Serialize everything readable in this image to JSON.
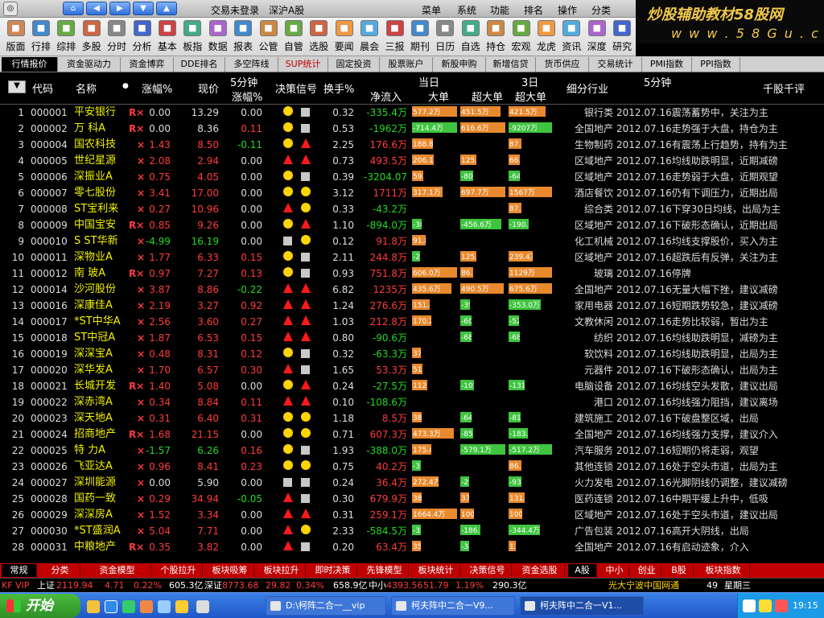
{
  "titlebar": {
    "login": "交易未登录",
    "market": "深沪A股",
    "menus": [
      "菜单",
      "系统",
      "功能",
      "排名",
      "操作",
      "分类"
    ]
  },
  "watermark": {
    "line1": "炒股辅助教材58股网",
    "line2": "w w w . 5 8 G u . c o m"
  },
  "toolbar": [
    "版面",
    "行排",
    "综排",
    "多股",
    "分时",
    "分析",
    "基本",
    "板指",
    "数据",
    "报表",
    "公管",
    "自管",
    "选股",
    "要闻",
    "晨会",
    "三报",
    "期刊",
    "日历",
    "自选",
    "持仓",
    "宏观",
    "龙虎",
    "资讯",
    "深度",
    "研究"
  ],
  "tabs_top": [
    "行情报价",
    "资金驱动力",
    "资金博弈",
    "DDE排名",
    "多空阵线",
    "SUP统计",
    "固定投资",
    "股票账户",
    "新股申购",
    "新增信贷",
    "货币供应",
    "交易统计",
    "PMI指数",
    "PPI指数"
  ],
  "header": {
    "code": "代码",
    "name": "名称",
    "chg": "涨幅%",
    "price": "现价",
    "m5_top": "5分钟",
    "m5": "涨幅%",
    "signal": "决策信号",
    "turnover": "换手%",
    "today": "当日",
    "flow": "净流入",
    "big": "大单",
    "super": "超大单",
    "day3": "3日",
    "d3super": "超大单",
    "industry": "细分行业",
    "comment_5m": "5分钟",
    "comment": "千股千评"
  },
  "colors": {
    "up": "#ff3b3b",
    "down": "#22d822",
    "flat": "#dddddd",
    "name": "#f2f200",
    "bar_pos": "#e8892e",
    "bar_neg": "#3fc43f",
    "signal_yellow": "#ffd400",
    "signal_red": "#ff1a1a",
    "signal_gray": "#c8c8c8"
  },
  "rows": [
    {
      "idx": "1",
      "code": "000001",
      "name": "平安银行",
      "tag": "R×",
      "chg": "0.00",
      "price": "13.29",
      "m5": "0.00",
      "sig": [
        "circle",
        "square"
      ],
      "turn": "0.32",
      "flow": "-335.4万",
      "big": "577.2万",
      "sup": "451.5万",
      "d3": "421.5万",
      "ind": "银行类",
      "cmt": "2012.07.16震荡蓄势中，关注为主"
    },
    {
      "idx": "2",
      "code": "000002",
      "name": "万  科A",
      "tag": "R×",
      "chg": "0.00",
      "price": "8.36",
      "m5": "0.11",
      "sig": [
        "circle",
        "square"
      ],
      "turn": "0.53",
      "flow": "-1962万",
      "big": "-714.4万",
      "sup": "616.6万",
      "d3": "-9207万",
      "ind": "全国地产",
      "cmt": "2012.07.16走势强于大盘，持仓为主"
    },
    {
      "idx": "3",
      "code": "000004",
      "name": "国农科技",
      "tag": "×",
      "chg": "1.43",
      "price": "8.50",
      "m5": "-0.11",
      "sig": [
        "circle",
        "tri"
      ],
      "turn": "2.25",
      "flow": "176.6万",
      "big": "188.8万",
      "sup": "",
      "d3": "87.0万",
      "ind": "生物制药",
      "cmt": "2012.07.16有震荡上行趋势，持有为主"
    },
    {
      "idx": "4",
      "code": "000005",
      "name": "世纪星源",
      "tag": "×",
      "chg": "2.08",
      "price": "2.94",
      "m5": "0.00",
      "sig": [
        "tri",
        "tri"
      ],
      "turn": "0.73",
      "flow": "493.5万",
      "big": "206.1万",
      "sup": "125.6万",
      "d3": "66.6万",
      "ind": "区域地产",
      "cmt": "2012.07.16均线助跌明显，近期减磅"
    },
    {
      "idx": "5",
      "code": "000006",
      "name": "深振业A",
      "tag": "×",
      "chg": "0.75",
      "price": "4.05",
      "m5": "0.00",
      "sig": [
        "circle",
        "square"
      ],
      "turn": "0.39",
      "flow": "-3204.07",
      "big": "59.5万",
      "sup": "-80.4万",
      "d3": "-64.4万",
      "ind": "区域地产",
      "cmt": "2012.07.16走势弱于大盘，近期观望"
    },
    {
      "idx": "6",
      "code": "000007",
      "name": "零七股份",
      "tag": "×",
      "chg": "3.41",
      "price": "17.00",
      "m5": "0.00",
      "sig": [
        "circle",
        "circle"
      ],
      "turn": "3.12",
      "flow": "1711万",
      "big": "317.1万",
      "sup": "697.7万",
      "d3": "1567万",
      "ind": "酒店餐饮",
      "cmt": "2012.07.16仍有下调压力，近期出局"
    },
    {
      "idx": "7",
      "code": "000008",
      "name": "ST宝利来",
      "tag": "×",
      "chg": "0.27",
      "price": "10.96",
      "m5": "0.00",
      "sig": [
        "tri",
        "circle"
      ],
      "turn": "0.33",
      "flow": "-43.2万",
      "big": "",
      "sup": "",
      "d3": "87.2万",
      "ind": "综合类",
      "cmt": "2012.07.16下穿30日均线，出局为主"
    },
    {
      "idx": "8",
      "code": "000009",
      "name": "中国宝安",
      "tag": "R×",
      "chg": "0.85",
      "price": "9.26",
      "m5": "0.00",
      "sig": [
        "circle",
        "tri"
      ],
      "turn": "1.10",
      "flow": "-894.0万",
      "big": "-38.8万",
      "sup": "-456.6万",
      "d3": "-190.5万",
      "ind": "区域地产",
      "cmt": "2012.07.16下破形态确认，近期出局"
    },
    {
      "idx": "9",
      "code": "000010",
      "name": "S ST华新",
      "tag": "×",
      "chg": "-4.99",
      "price": "16.19",
      "m5": "0.00",
      "sig": [
        "square",
        "circle"
      ],
      "turn": "0.12",
      "flow": "91.8万",
      "big": "91.8万",
      "sup": "",
      "d3": "",
      "ind": "化工机械",
      "cmt": "2012.07.16均线支撑股价，买入为主"
    },
    {
      "idx": "10",
      "code": "000011",
      "name": "深物业A",
      "tag": "×",
      "chg": "1.77",
      "price": "6.33",
      "m5": "0.15",
      "sig": [
        "circle",
        "square"
      ],
      "turn": "2.11",
      "flow": "244.8万",
      "big": "-25.0万",
      "sup": "125.6万",
      "d3": "239.4万",
      "ind": "区域地产",
      "cmt": "2012.07.16超跌后有反弹，关注为主"
    },
    {
      "idx": "11",
      "code": "000012",
      "name": "南  玻A",
      "tag": "R×",
      "chg": "0.97",
      "price": "7.27",
      "m5": "0.13",
      "sig": [
        "circle",
        "square"
      ],
      "turn": "0.93",
      "flow": "751.8万",
      "big": "606.0万",
      "sup": "86.8万",
      "d3": "1129万",
      "ind": "玻璃",
      "cmt": "2012.07.16停牌"
    },
    {
      "idx": "12",
      "code": "000014",
      "name": "沙河股份",
      "tag": "×",
      "chg": "3.87",
      "price": "8.86",
      "m5": "-0.22",
      "sig": [
        "tri",
        "tri"
      ],
      "turn": "6.82",
      "flow": "1235万",
      "big": "435.6万",
      "sup": "490.5万",
      "d3": "675.6万",
      "ind": "全国地产",
      "cmt": "2012.07.16无量大幅下挫，建议减磅"
    },
    {
      "idx": "13",
      "code": "000016",
      "name": "深康佳A",
      "tag": "×",
      "chg": "2.19",
      "price": "3.27",
      "m5": "0.92",
      "sig": [
        "tri",
        "tri"
      ],
      "turn": "1.24",
      "flow": "276.6万",
      "big": "151.4万",
      "sup": "-39.2万",
      "d3": "-353.0万",
      "ind": "家用电器",
      "cmt": "2012.07.16短期跌势较急，建议减磅"
    },
    {
      "idx": "14",
      "code": "000017",
      "name": "*ST中华A",
      "tag": "×",
      "chg": "2.56",
      "price": "3.60",
      "m5": "0.27",
      "sig": [
        "tri",
        "tri"
      ],
      "turn": "1.03",
      "flow": "212.8万",
      "big": "170.2万",
      "sup": "-60.9万",
      "d3": "-52.9万",
      "ind": "文教休闲",
      "cmt": "2012.07.16走势比较弱，暂出为主"
    },
    {
      "idx": "15",
      "code": "000018",
      "name": "ST中冠A",
      "tag": "×",
      "chg": "1.87",
      "price": "6.53",
      "m5": "0.15",
      "sig": [
        "tri",
        "tri"
      ],
      "turn": "0.80",
      "flow": "-90.6万",
      "big": "",
      "sup": "-68.3万",
      "d3": "-68.3万",
      "ind": "纺织",
      "cmt": "2012.07.16均线助跌明显，减磅为主"
    },
    {
      "idx": "16",
      "code": "000019",
      "name": "深深宝A",
      "tag": "×",
      "chg": "0.48",
      "price": "8.31",
      "m5": "0.12",
      "sig": [
        "circle",
        "square"
      ],
      "turn": "0.32",
      "flow": "-63.3万",
      "big": "37.0万",
      "sup": "",
      "d3": "",
      "ind": "软饮料",
      "cmt": "2012.07.16均线助跌明显，出局为主"
    },
    {
      "idx": "17",
      "code": "000020",
      "name": "深华发A",
      "tag": "×",
      "chg": "1.70",
      "price": "6.57",
      "m5": "0.30",
      "sig": [
        "tri",
        "square"
      ],
      "turn": "1.65",
      "flow": "53.3万",
      "big": "51.7万",
      "sup": "",
      "d3": "",
      "ind": "元器件",
      "cmt": "2012.07.16下破形态确认，出局为主"
    },
    {
      "idx": "18",
      "code": "000021",
      "name": "长城开发",
      "tag": "R×",
      "chg": "1.40",
      "price": "5.08",
      "m5": "0.00",
      "sig": [
        "circle",
        "tri"
      ],
      "turn": "0.24",
      "flow": "-27.5万",
      "big": "112.7万",
      "sup": "-101.3万",
      "d3": "-131.2万",
      "ind": "电脑设备",
      "cmt": "2012.07.16均线空头发散，建议出局"
    },
    {
      "idx": "19",
      "code": "000022",
      "name": "深赤湾A",
      "tag": "×",
      "chg": "0.34",
      "price": "8.84",
      "m5": "0.11",
      "sig": [
        "tri",
        "tri"
      ],
      "turn": "0.10",
      "flow": "-108.6万",
      "big": "",
      "sup": "",
      "d3": "",
      "ind": "港口",
      "cmt": "2012.07.16均线强力阻挡，建议离场"
    },
    {
      "idx": "20",
      "code": "000023",
      "name": "深天地A",
      "tag": "×",
      "chg": "0.31",
      "price": "6.40",
      "m5": "0.31",
      "sig": [
        "circle",
        "circle"
      ],
      "turn": "1.18",
      "flow": "8.5万",
      "big": "38.6万",
      "sup": "-64.5万",
      "d3": "-81.7万",
      "ind": "建筑施工",
      "cmt": "2012.07.16下破盘整区域，出局"
    },
    {
      "idx": "21",
      "code": "000024",
      "name": "招商地产",
      "tag": "R×",
      "chg": "1.68",
      "price": "21.15",
      "m5": "0.00",
      "sig": [
        "circle",
        "circle"
      ],
      "turn": "0.71",
      "flow": "607.3万",
      "big": "473.3万",
      "sup": "-85.0万",
      "d3": "-183.2万",
      "ind": "全国地产",
      "cmt": "2012.07.16均线强力支撑，建议介入"
    },
    {
      "idx": "22",
      "code": "000025",
      "name": "特  力A",
      "tag": "×",
      "chg": "-1.57",
      "price": "6.26",
      "m5": "0.16",
      "sig": [
        "circle",
        "square"
      ],
      "turn": "1.93",
      "flow": "-388.0万",
      "big": "175.4万",
      "sup": "-579.1万",
      "d3": "-517.2万",
      "ind": "汽车服务",
      "cmt": "2012.07.16短期仍将走弱，观望"
    },
    {
      "idx": "23",
      "code": "000026",
      "name": "飞亚达A",
      "tag": "×",
      "chg": "0.96",
      "price": "8.41",
      "m5": "0.23",
      "sig": [
        "circle",
        "circle"
      ],
      "turn": "0.75",
      "flow": "40.2万",
      "big": "-31.7万",
      "sup": "",
      "d3": "86.7万",
      "ind": "其他连锁",
      "cmt": "2012.07.16处于空头市道，出局为主"
    },
    {
      "idx": "24",
      "code": "000027",
      "name": "深圳能源",
      "tag": "×",
      "chg": "0.00",
      "price": "5.90",
      "m5": "0.00",
      "sig": [
        "square",
        "square"
      ],
      "turn": "0.24",
      "flow": "36.4万",
      "big": "272.4万",
      "sup": "-29.8万",
      "d3": "-93.9万",
      "ind": "火力发电",
      "cmt": "2012.07.16光脚阴线仍调整，建议减磅"
    },
    {
      "idx": "25",
      "code": "000028",
      "name": "国药一致",
      "tag": "×",
      "chg": "0.29",
      "price": "34.94",
      "m5": "-0.05",
      "sig": [
        "tri",
        "square"
      ],
      "turn": "0.30",
      "flow": "679.9万",
      "big": "38.0万",
      "sup": "37.3万",
      "d3": "131.2万",
      "ind": "医药连锁",
      "cmt": "2012.07.16中期平缓上升中，低吸"
    },
    {
      "idx": "26",
      "code": "000029",
      "name": "深深房A",
      "tag": "×",
      "chg": "1.52",
      "price": "3.34",
      "m5": "0.00",
      "sig": [
        "tri",
        "tri"
      ],
      "turn": "0.31",
      "flow": "259.1万",
      "big": "1664.4万",
      "sup": "100.3万",
      "d3": "100.3万",
      "ind": "区域地产",
      "cmt": "2012.07.16处于空头市道，建议出局"
    },
    {
      "idx": "27",
      "code": "000030",
      "name": "*ST盛润A",
      "tag": "×",
      "chg": "5.04",
      "price": "7.71",
      "m5": "0.00",
      "sig": [
        "tri",
        "circle"
      ],
      "turn": "2.33",
      "flow": "-584.5万",
      "big": "-32.5万",
      "sup": "-186.1万",
      "d3": "-344.4万",
      "ind": "广告包装",
      "cmt": "2012.07.16高开大阴线，出局"
    },
    {
      "idx": "28",
      "code": "000031",
      "name": "中粮地产",
      "tag": "R×",
      "chg": "0.35",
      "price": "3.82",
      "m5": "0.00",
      "sig": [
        "tri",
        "square"
      ],
      "turn": "0.20",
      "flow": "63.4万",
      "big": "35.9万",
      "sup": "-34.8万",
      "d3": "11.2万",
      "ind": "全国地产",
      "cmt": "2012.07.16有启动迹象，介入"
    }
  ],
  "tabs_bottom": [
    "常规",
    "分类",
    "资金模型",
    "个股拉升",
    "板块吸筹",
    "板块拉升",
    "即时决策",
    "先锋模型",
    "板块统计",
    "决策信号",
    "资金选股",
    "A股",
    "中小",
    "创业",
    "B股",
    "板块指数"
  ],
  "ticker": {
    "vip": "KF VIP",
    "sh_label": "上证",
    "sh_value": "2119.94",
    "sh_chg": "4.71",
    "sh_pct": "0.22%",
    "sh_amt": "605.3亿",
    "sz_label": "深证",
    "sz_value": "8773.68",
    "sz_chg": "29.82",
    "sz_pct": "0.34%",
    "sz_amt": "658.9亿",
    "zx_label": "中小",
    "zx_value": "4393.56",
    "zx_chg": "51.79",
    "zx_pct": "1.19%",
    "zx_amt": "290.3亿",
    "news": "光大宁波中国网通",
    "num": "49",
    "weekday": "星期三"
  },
  "taskbar": {
    "start": "开始",
    "tasks": [
      "D:\\柯阵二合一__vip",
      "柯夫阵中二合一V9...",
      "柯夫阵中二合一V1..."
    ],
    "clock": "19:15"
  }
}
